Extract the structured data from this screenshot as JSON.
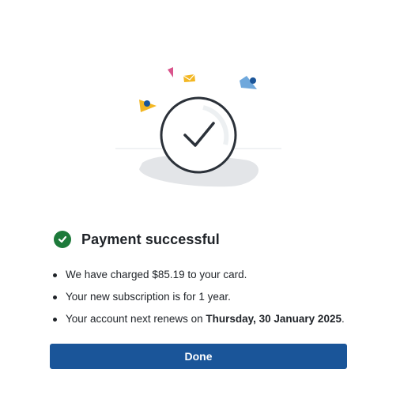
{
  "dialog": {
    "title": "Payment successful",
    "status_icon": "check-circle-icon",
    "illustration_icon": "checkmark-celebration-illustration",
    "details": {
      "charge_prefix": "We have charged ",
      "charge_amount": "$85.19",
      "charge_suffix": " to your card.",
      "subscription_text": "Your new subscription is for 1 year.",
      "renewal_prefix": "Your account next renews on ",
      "renewal_date": "Thursday, 30 January 2025",
      "renewal_suffix": "."
    },
    "done_label": "Done"
  },
  "colors": {
    "success": "#1d7a3a",
    "primary": "#1a5599",
    "text": "#1f2328"
  }
}
